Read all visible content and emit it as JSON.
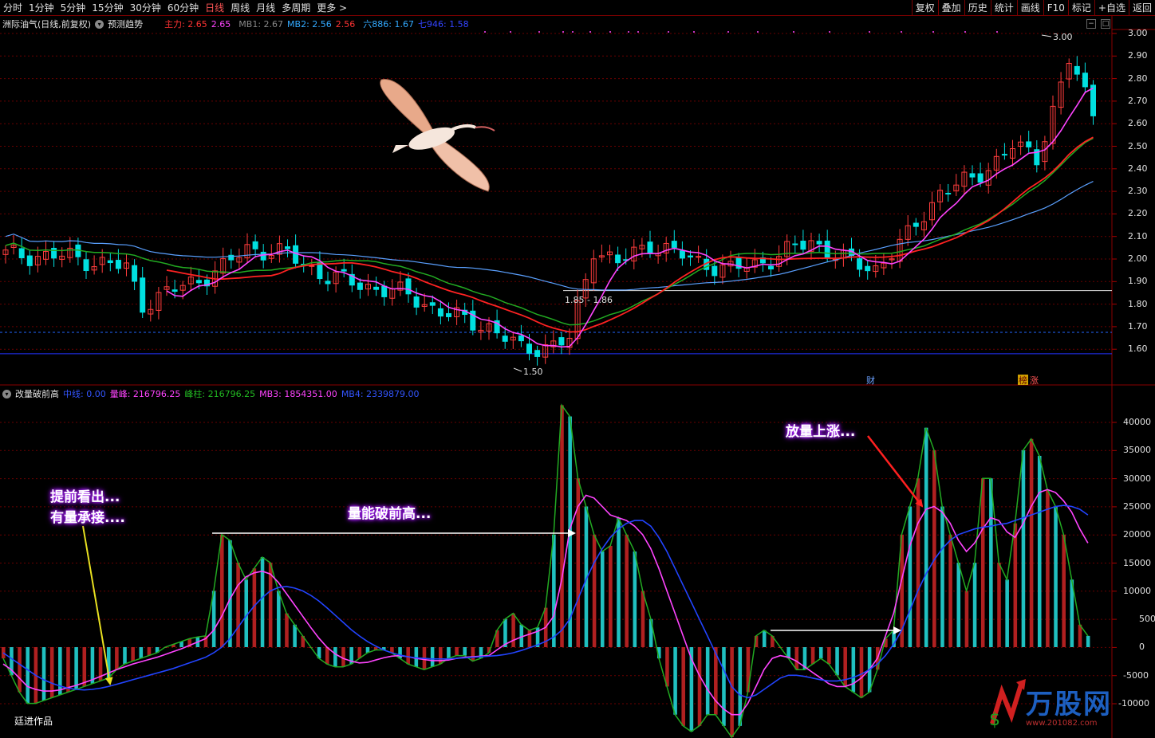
{
  "toolbar": {
    "periods": [
      "分时",
      "1分钟",
      "5分钟",
      "15分钟",
      "30分钟",
      "60分钟",
      "日线",
      "周线",
      "月线",
      "多周期",
      "更多 >"
    ],
    "active_period": "日线",
    "tools": [
      "复权",
      "叠加",
      "历史",
      "统计",
      "画线",
      "F10",
      "标记",
      "+自选",
      "返回"
    ]
  },
  "main_legend": {
    "title": "洲际油气(日线,前复权)",
    "forecast": "预测趋势",
    "items": [
      {
        "text": "主力: 2.65",
        "color": "#ff3333"
      },
      {
        "text": "2.65",
        "color": "#ff44ff"
      },
      {
        "text": "MB1: 2.67",
        "color": "#888888"
      },
      {
        "text": "MB2: 2.56",
        "color": "#33aaff"
      },
      {
        "text": "2.56",
        "color": "#ff3333"
      },
      {
        "text": "六886: 1.67",
        "color": "#33aaff"
      },
      {
        "text": "七946: 1.58",
        "color": "#3344ff"
      }
    ]
  },
  "sub_legend": {
    "title": "改量破前高",
    "items": [
      {
        "text": "中线: 0.00",
        "color": "#3355ff"
      },
      {
        "text": "量峰: 216796.25",
        "color": "#ff44ff"
      },
      {
        "text": "峰柱: 216796.25",
        "color": "#22bb22"
      },
      {
        "text": "MB3: 1854351.00",
        "color": "#ff44ff"
      },
      {
        "text": "MB4: 2339879.00",
        "color": "#3355ff"
      }
    ]
  },
  "price_axis": [
    "3.00",
    "2.90",
    "2.80",
    "2.70",
    "2.60",
    "2.50",
    "2.40",
    "2.30",
    "2.20",
    "2.10",
    "2.00",
    "1.90",
    "1.80",
    "1.70",
    "1.60"
  ],
  "volume_axis": [
    "40000",
    "35000",
    "30000",
    "25000",
    "20000",
    "15000",
    "10000",
    "5000",
    "0",
    "-5000",
    "-10000"
  ],
  "annotations": {
    "high": "3.00",
    "low": "1.50",
    "range": "1.85 - 1.86",
    "event_cai": "财",
    "event_bang": "榜",
    "event_zhang": "涨"
  },
  "notes": {
    "early_line1": "提前看出...",
    "early_line2": "有量承接....",
    "breakout": "量能破前高...",
    "rise": "放量上涨..."
  },
  "author": "廷进作品",
  "watermark": {
    "brand": "万股网",
    "url": "www.201082.com"
  },
  "chart_data": [
    {
      "type": "candlestick",
      "title": "洲际油气(日线,前复权)",
      "ylim": [
        1.5,
        3.05
      ],
      "high": 3.0,
      "low": 1.5,
      "support_level": 1.86,
      "lines": {
        "主力": 2.65,
        "MB1": 2.67,
        "MB2": 2.56,
        "六886": 1.67,
        "七946": 1.58
      }
    },
    {
      "type": "bar",
      "title": "改量破前高",
      "ylim": [
        -15000,
        44000
      ],
      "values": [
        -2000,
        -5000,
        -8000,
        -10000,
        -10000,
        -9500,
        -9000,
        -8500,
        -8000,
        -7500,
        -7000,
        -6500,
        -6000,
        -5500,
        -4000,
        -3000,
        -2500,
        -2000,
        -1500,
        -1000,
        0,
        500,
        1000,
        1500,
        1800,
        2000,
        10000,
        20000,
        19000,
        15000,
        12000,
        14000,
        16000,
        15000,
        10000,
        6000,
        4000,
        2000,
        0,
        -2000,
        -3000,
        -3500,
        -3500,
        -3000,
        -2000,
        -1000,
        -500,
        -500,
        -1000,
        -2000,
        -3000,
        -3500,
        -4000,
        -3500,
        -3000,
        -2000,
        -1500,
        -1500,
        -2500,
        -2000,
        -1000,
        3000,
        5000,
        6000,
        4000,
        3000,
        3500,
        7000,
        20000,
        43000,
        41000,
        30000,
        25000,
        20000,
        17000,
        18000,
        23000,
        20000,
        17000,
        10000,
        5000,
        -2000,
        -7000,
        -12000,
        -14000,
        -15000,
        -14000,
        -12000,
        -12000,
        -14000,
        -16000,
        -14000,
        -8000,
        2000,
        3000,
        2000,
        0,
        -2000,
        -4000,
        -4000,
        -3000,
        -2000,
        -3000,
        -5000,
        -7000,
        -8000,
        -9000,
        -8000,
        -4000,
        1500,
        3000,
        20000,
        25000,
        30000,
        39000,
        35000,
        25000,
        20000,
        15000,
        10000,
        15000,
        30000,
        30000,
        15000,
        12000,
        22000,
        35000,
        37000,
        34000,
        28000,
        25000,
        20000,
        12000,
        4000,
        2000
      ],
      "series": [
        {
          "name": "MB3",
          "values": [
            -3000,
            -4000,
            -5500,
            -7000,
            -7500,
            -7800,
            -7800,
            -7600,
            -7200,
            -6800,
            -6300,
            -5800,
            -5200,
            -4600,
            -4000,
            -3500,
            -3000,
            -2600,
            -2200,
            -1800,
            -1300,
            -800,
            -300,
            300,
            900,
            1500,
            3000,
            5500,
            8500,
            11000,
            12500,
            13200,
            13500,
            13000,
            11500,
            9500,
            7500,
            5500,
            3500,
            1600,
            0,
            -1200,
            -2000,
            -2500,
            -2800,
            -2700,
            -2300,
            -1900,
            -1600,
            -1500,
            -1700,
            -2000,
            -2200,
            -2400,
            -2400,
            -2300,
            -2000,
            -1800,
            -1700,
            -1600,
            -1500,
            -500,
            500,
            1200,
            1800,
            2300,
            2800,
            3500,
            5500,
            12000,
            21000,
            25000,
            27000,
            26500,
            25000,
            23500,
            23000,
            22500,
            21500,
            20000,
            17500,
            14000,
            10000,
            6000,
            2000,
            -2000,
            -5000,
            -7500,
            -9500,
            -11000,
            -12000,
            -12000,
            -10000,
            -7000,
            -4000,
            -2000,
            -1500,
            -1800,
            -2500,
            -3500,
            -4500,
            -5500,
            -6500,
            -7000,
            -7000,
            -6500,
            -5500,
            -4000,
            -2000,
            2000,
            6000,
            12000,
            18000,
            22000,
            24500,
            25000,
            24000,
            22000,
            19000,
            17000,
            18500,
            21000,
            23000,
            22500,
            20500,
            19500,
            22000,
            25000,
            27500,
            28000,
            27500,
            26000,
            24000,
            21000,
            18500
          ]
        },
        {
          "name": "MB4",
          "values": [
            -1000,
            -2000,
            -3000,
            -4000,
            -5000,
            -5800,
            -6400,
            -6900,
            -7300,
            -7500,
            -7600,
            -7500,
            -7300,
            -7000,
            -6600,
            -6200,
            -5800,
            -5400,
            -5000,
            -4600,
            -4200,
            -3800,
            -3300,
            -2800,
            -2300,
            -1800,
            -1000,
            0,
            1500,
            3500,
            5500,
            7300,
            8800,
            10000,
            10600,
            10800,
            10500,
            10000,
            9200,
            8200,
            7000,
            5700,
            4400,
            3100,
            2000,
            1000,
            200,
            -500,
            -1000,
            -1400,
            -1700,
            -1900,
            -2000,
            -2100,
            -2100,
            -2100,
            -2000,
            -1900,
            -1800,
            -1700,
            -1600,
            -1500,
            -1300,
            -1000,
            -600,
            -100,
            400,
            1000,
            1800,
            3000,
            5000,
            8500,
            12000,
            15000,
            17500,
            19500,
            21000,
            22000,
            22500,
            22500,
            21500,
            19500,
            17000,
            14000,
            11000,
            8000,
            5000,
            2000,
            -1000,
            -4000,
            -7000,
            -8500,
            -9000,
            -8500,
            -7500,
            -6500,
            -5500,
            -5000,
            -5000,
            -5200,
            -5500,
            -5800,
            -6000,
            -6000,
            -5800,
            -5400,
            -4800,
            -4000,
            -3000,
            -1500,
            500,
            3000,
            6500,
            10000,
            13000,
            15500,
            17500,
            19000,
            20000,
            20500,
            21000,
            21300,
            21500,
            21800,
            22000,
            22500,
            23000,
            23500,
            24000,
            24500,
            25000,
            25200,
            25000,
            24500,
            23500
          ]
        }
      ]
    }
  ]
}
